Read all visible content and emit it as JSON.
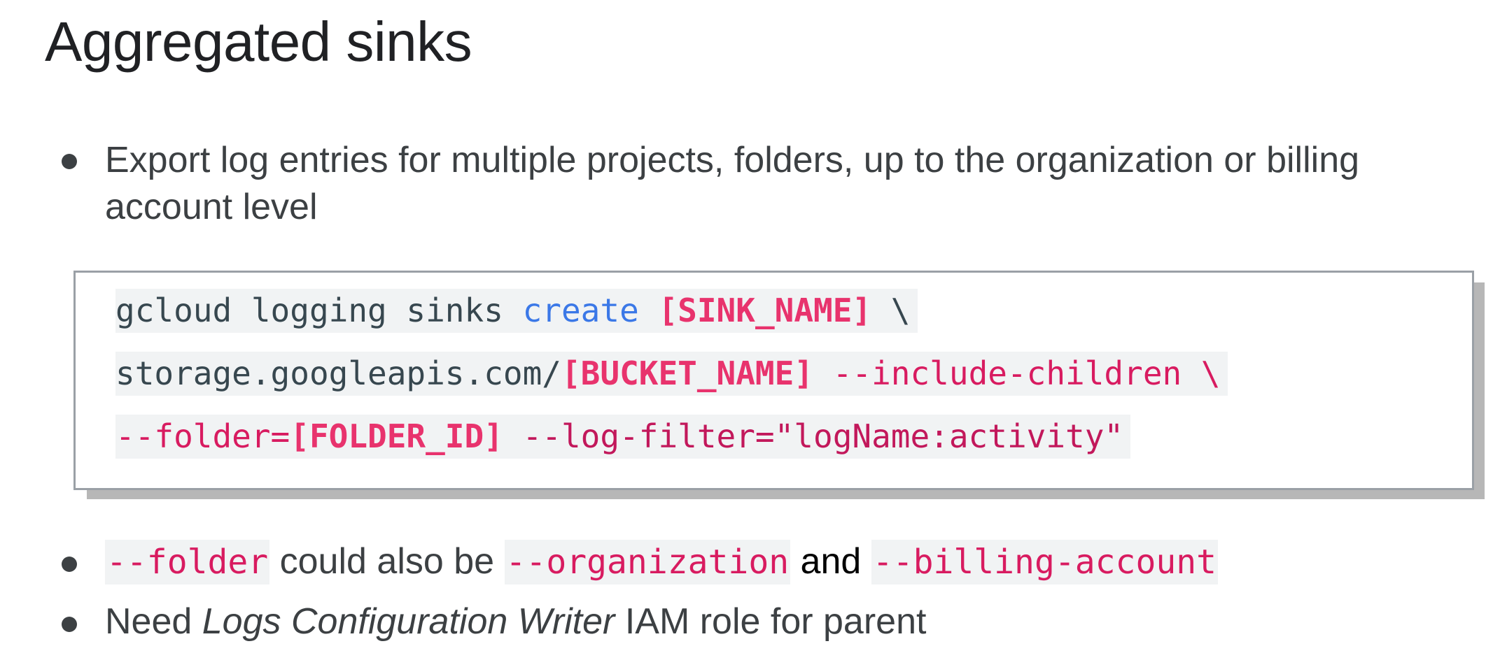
{
  "slide": {
    "title": "Aggregated sinks",
    "bullet1": {
      "text": "Export log entries for multiple projects, folders, up to the organization or billing account level"
    },
    "code": {
      "line1": {
        "cmd": "gcloud logging sinks ",
        "verb": "create",
        "sp": " ",
        "sink": "[SINK_NAME]",
        "cont": " \\"
      },
      "line2": {
        "dest": "storage.googleapis.com/",
        "bucket": "[BUCKET_NAME]",
        "flag": " --include-children \\"
      },
      "line3": {
        "folder_flag": "--folder=",
        "folder_id": "[FOLDER_ID]",
        "filter": " --log-filter=\"logName:activity\""
      }
    },
    "bullet2": {
      "code1": "--folder",
      "text1": " could also be ",
      "code2": "--organization",
      "text2": " and ",
      "code3": "--billing-account"
    },
    "bullet3": {
      "text1": "Need ",
      "role": "Logs Configuration Writer",
      "text2": " IAM role for parent"
    }
  },
  "colors": {
    "keyword": "#3b78e7",
    "placeholder": "#e8336d",
    "flag": "#d81b60",
    "text": "#3c4043",
    "code_bg": "#f1f3f4"
  }
}
